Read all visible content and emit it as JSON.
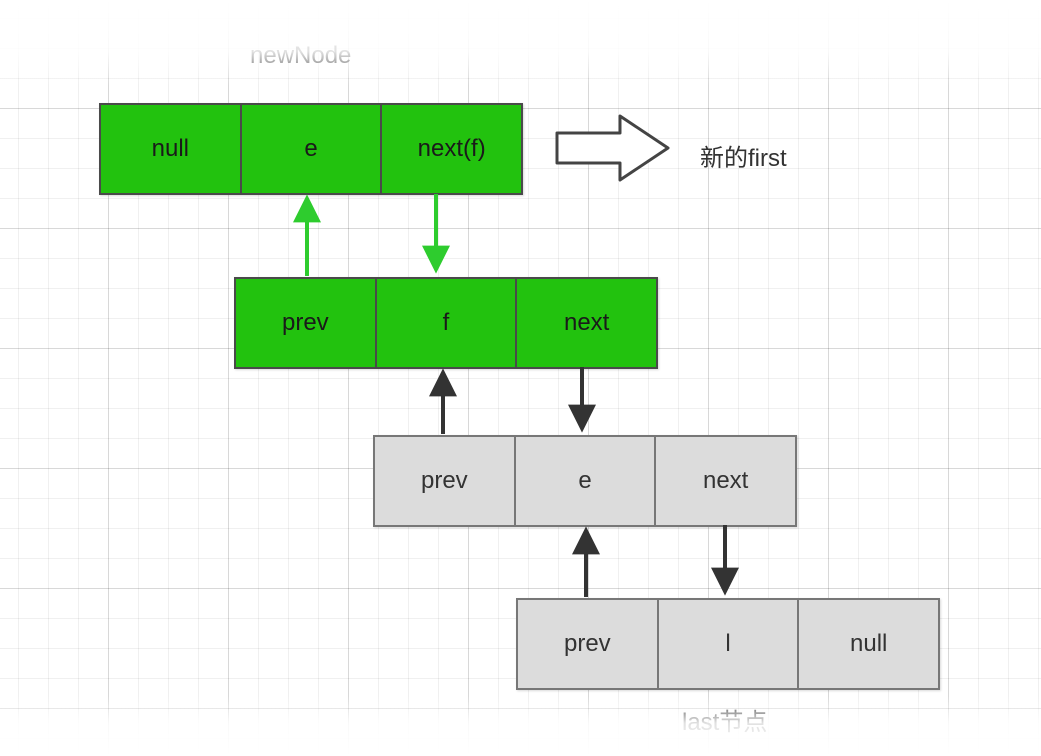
{
  "labels": {
    "newNode": "newNode",
    "newFirst": "新的first",
    "lastNode": "last节点"
  },
  "nodes": {
    "n1": {
      "cells": [
        "null",
        "e",
        "next(f)"
      ]
    },
    "n2": {
      "cells": [
        "prev",
        "f",
        "next"
      ]
    },
    "n3": {
      "cells": [
        "prev",
        "e",
        "next"
      ]
    },
    "n4": {
      "cells": [
        "prev",
        "l",
        "null"
      ]
    }
  },
  "colors": {
    "green": "#22c20e",
    "grey": "#dcdcdc",
    "arrowGreen": "#2ecc2e",
    "arrowDark": "#333333"
  }
}
